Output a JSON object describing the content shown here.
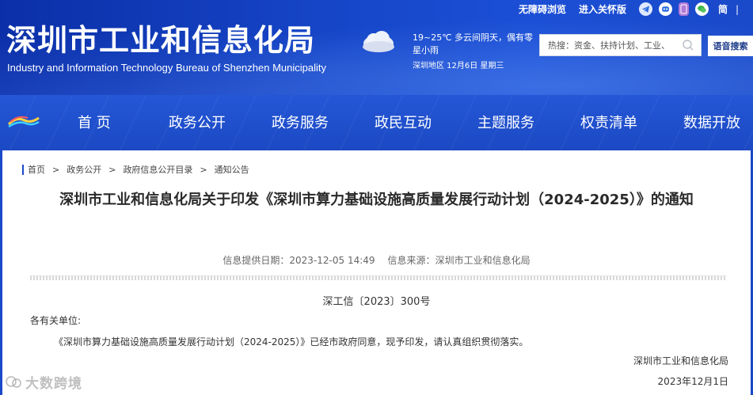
{
  "header": {
    "title": "深圳市工业和信息化局",
    "subtitle": "Industry and Information Technology Bureau of Shenzhen Municipality",
    "weather": {
      "text": "19~25℃ 多云间阴天，偶有零星小雨",
      "date": "深圳地区 12月6日 星期三",
      "icon": "cloud-icon"
    },
    "top_links": {
      "accessibility": "无障碍浏览",
      "elderly": "进入关怀版",
      "simplified": "简",
      "separator": "|"
    },
    "search": {
      "placeholder": "热搜：资金、扶持计划、工业、"
    },
    "voice_search": "语音搜索"
  },
  "nav": {
    "items": [
      "首 页",
      "政务公开",
      "政务服务",
      "政民互动",
      "主题服务",
      "权责清单",
      "数据开放"
    ]
  },
  "breadcrumb": [
    "首页",
    "政务公开",
    "政府信息公开目录",
    "通知公告"
  ],
  "article": {
    "title": "深圳市工业和信息化局关于印发《深圳市算力基础设施高质量发展行动计划（2024-2025）》的通知",
    "publish_label": "信息提供日期：2023-12-05 14:49",
    "source_label": "信息来源：",
    "source": "深圳市工业和信息化局",
    "doc_number": "深工信〔2023〕300号",
    "recipient": "各有关单位:",
    "body": "《深圳市算力基础设施高质量发展行动计划（2024-2025）》已经市政府同意，现予印发，请认真组织贯彻落实。",
    "signer": "深圳市工业和信息化局",
    "sign_date": "2023年12月1日"
  },
  "watermark": "大数跨境",
  "colors": {
    "banner": "#1646c8",
    "nav": "#2457d6",
    "accent": "#1a49c9"
  }
}
